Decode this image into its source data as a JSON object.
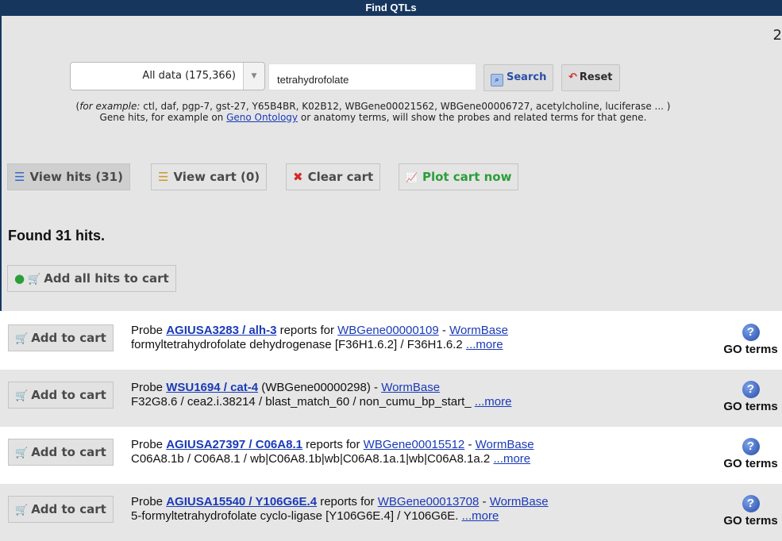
{
  "header": {
    "title": "Find QTLs",
    "page_number": "2"
  },
  "search": {
    "dataset_selected": "All data (175,366)",
    "query_value": "tetrahydrofolate",
    "search_label": "Search",
    "reset_label": "Reset",
    "examples_prefix": "(",
    "examples_italic": "for example:",
    "examples_list": " ctl, daf, pgp-7, gst-27, Y65B4BR, K02B12, WBGene00021562, WBGene00006727, acetylcholine, luciferase ... )",
    "hint_before": "Gene hits, for example on ",
    "hint_link": "Geno Ontology",
    "hint_after": " or anatomy terms, will show the probes and related terms for that gene."
  },
  "actions": {
    "view_hits": "View hits (31)",
    "view_cart": "View cart (0)",
    "clear_cart": "Clear cart",
    "plot_cart": "Plot cart now"
  },
  "results": {
    "found_text": "Found 31 hits.",
    "add_all_label": "Add all hits to cart",
    "add_label": "Add to cart",
    "go_label": "GO terms",
    "more_label": "...more",
    "items": [
      {
        "probe_prefix": "Probe ",
        "probe_name": "AGIUSA3283 / alh-3",
        "mid": " reports for ",
        "gene_link": "WBGene00000109",
        "sep": " - ",
        "db_link": "WormBase",
        "line2": "formyltetrahydrofolate dehydrogenase [F36H1.6.2] / F36H1.6.2 "
      },
      {
        "probe_prefix": "Probe ",
        "probe_name": "WSU1694 / cat-4",
        "mid": " (WBGene00000298) - ",
        "gene_link": "",
        "sep": "",
        "db_link": "WormBase",
        "line2": "F32G8.6 / cea2.i.38214 / blast_match_60 / non_cumu_bp_start_ "
      },
      {
        "probe_prefix": "Probe ",
        "probe_name": "AGIUSA27397 / C06A8.1",
        "mid": " reports for ",
        "gene_link": "WBGene00015512",
        "sep": " - ",
        "db_link": "WormBase",
        "line2": "C06A8.1b / C06A8.1 / wb|C06A8.1b|wb|C06A8.1a.1|wb|C06A8.1a.2 "
      },
      {
        "probe_prefix": "Probe ",
        "probe_name": "AGIUSA15540 / Y106G6E.4",
        "mid": " reports for ",
        "gene_link": "WBGene00013708",
        "sep": " - ",
        "db_link": "WormBase",
        "line2": "5-formyltetrahydrofolate cyclo-ligase [Y106G6E.4] / Y106G6E. "
      }
    ]
  }
}
